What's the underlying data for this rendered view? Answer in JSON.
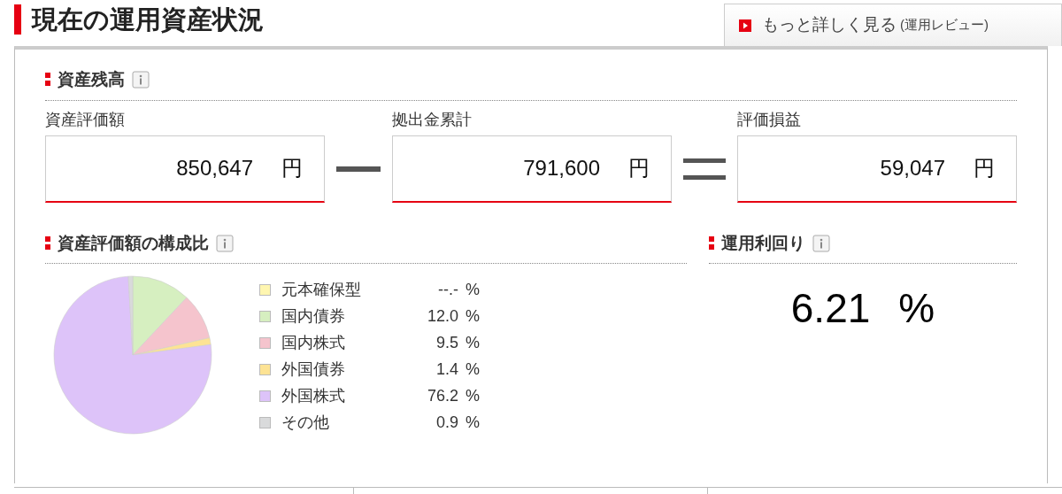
{
  "page_title": "現在の運用資産状況",
  "more_link": {
    "label": "もっと詳しく見る",
    "sub": "(運用レビュー)"
  },
  "balance": {
    "title": "資産残高",
    "fields": [
      {
        "label": "資産評価額",
        "value": "850,647",
        "unit": "円"
      },
      {
        "label": "拠出金累計",
        "value": "791,600",
        "unit": "円"
      },
      {
        "label": "評価損益",
        "value": "59,047",
        "unit": "円"
      }
    ]
  },
  "composition": {
    "title": "資産評価額の構成比",
    "legend": [
      {
        "value": "--.-",
        "unit": "%",
        "color": "#fff6b0"
      },
      {
        "value": "12.0",
        "unit": "%",
        "color": "#d6efc0"
      },
      {
        "value": "9.5",
        "unit": "%",
        "color": "#f5c4cd"
      },
      {
        "value": "1.4",
        "unit": "%",
        "color": "#fde394"
      },
      {
        "value": "76.2",
        "unit": "%",
        "color": "#ddc3f9"
      },
      {
        "value": "0.9",
        "unit": "%",
        "color": "#d9dadb"
      }
    ],
    "chart_data": {
      "type": "pie",
      "categories": [
        "元本確保型",
        "国内債券",
        "国内株式",
        "外国債券",
        "外国株式",
        "その他"
      ],
      "values": [
        null,
        12.0,
        9.5,
        1.4,
        76.2,
        0.9
      ]
    }
  },
  "yield": {
    "title": "運用利回り",
    "value": "6.21",
    "unit": "%"
  }
}
